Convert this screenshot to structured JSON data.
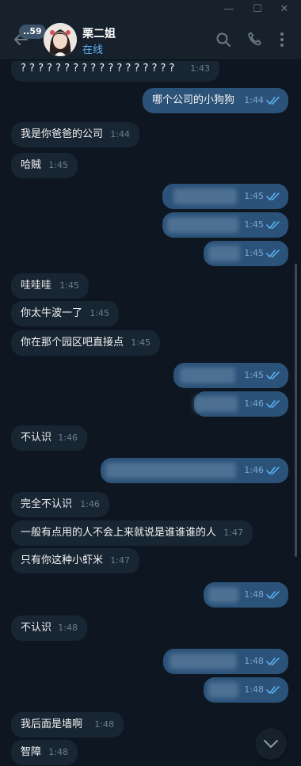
{
  "header": {
    "back_count": "..59",
    "contact_name": "栗二姐",
    "status": "在线"
  },
  "messages": [
    {
      "text": "? ? ? ? ? ? ? ? ? ? ? ? ? ? ? ? ? ?",
      "time": "1:43"
    },
    {
      "text": "哪个公司的小狗狗",
      "time": "1:44"
    },
    {
      "text": "我是你爸爸的公司",
      "time": "1:44"
    },
    {
      "text": "哈贼",
      "time": "1:45"
    },
    {
      "text": "",
      "time": "1:45"
    },
    {
      "text": "",
      "time": "1:45"
    },
    {
      "text": "",
      "time": "1:45"
    },
    {
      "text": "哇哇哇",
      "time": "1:45"
    },
    {
      "text": "你太牛波一了",
      "time": "1:45"
    },
    {
      "text": "你在那个园区吧直接点",
      "time": "1:45"
    },
    {
      "text": "",
      "time": "1:45"
    },
    {
      "text": "",
      "time": "1:46"
    },
    {
      "text": "不认识",
      "time": "1:46"
    },
    {
      "text": "",
      "time": "1:46"
    },
    {
      "text": "完全不认识",
      "time": "1:46"
    },
    {
      "text": "一般有点用的人不会上来就说是谁谁谁的人",
      "time": "1:47"
    },
    {
      "text": "只有你这种小虾米",
      "time": "1:47"
    },
    {
      "text": "",
      "time": "1:48"
    },
    {
      "text": "不认识",
      "time": "1:48"
    },
    {
      "text": "",
      "time": "1:48"
    },
    {
      "text": "",
      "time": "1:48"
    },
    {
      "text": "我后面是墙啊",
      "time": "1:48"
    },
    {
      "text": "智障",
      "time": "1:48"
    }
  ],
  "colors": {
    "background": "#0e1621",
    "incoming_bubble": "#182533",
    "outgoing_bubble": "#2b5278",
    "accent": "#5eb5f7"
  }
}
